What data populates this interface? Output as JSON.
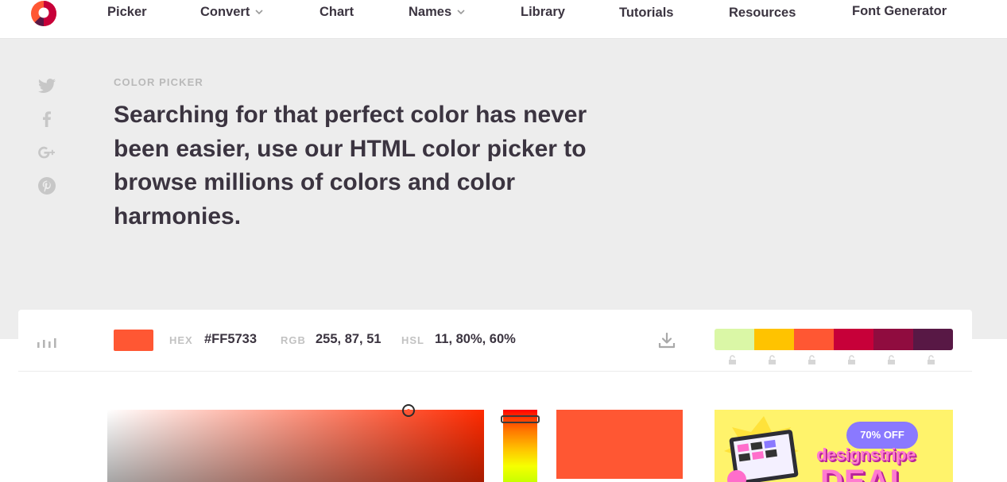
{
  "nav": {
    "items": [
      {
        "label": "Picker",
        "has_dropdown": false
      },
      {
        "label": "Convert",
        "has_dropdown": true
      },
      {
        "label": "Chart",
        "has_dropdown": false
      },
      {
        "label": "Names",
        "has_dropdown": true
      },
      {
        "label": "Library",
        "has_dropdown": false
      },
      {
        "label": "Tutorials",
        "has_dropdown": false
      },
      {
        "label": "Resources",
        "has_dropdown": false
      },
      {
        "label": "Font Generator",
        "has_dropdown": false
      }
    ]
  },
  "social": {
    "icons": [
      "twitter-icon",
      "facebook-icon",
      "google-plus-icon",
      "pinterest-icon"
    ]
  },
  "hero": {
    "eyebrow": "COLOR PICKER",
    "headline": "Searching for that perfect color has never been easier, use our HTML color picker to browse millions of colors and color harmonies."
  },
  "picker": {
    "current_color": "#FF5733",
    "hex": {
      "label": "HEX",
      "value": "#FF5733"
    },
    "rgb": {
      "label": "RGB",
      "value": "255, 87, 51"
    },
    "hsl": {
      "label": "HSL",
      "value": "11, 80%, 60%"
    },
    "palette": [
      "#DAF7A6",
      "#FFC300",
      "#FF5733",
      "#C70039",
      "#900C3F",
      "#581845"
    ]
  },
  "ad": {
    "badge": "70% OFF",
    "brand": "designstripe",
    "headline": "DEAL"
  },
  "colors": {
    "accent": "#FF5733",
    "text": "#3B3440",
    "muted": "#C2C2C2",
    "hero_bg": "#EDEDED"
  }
}
